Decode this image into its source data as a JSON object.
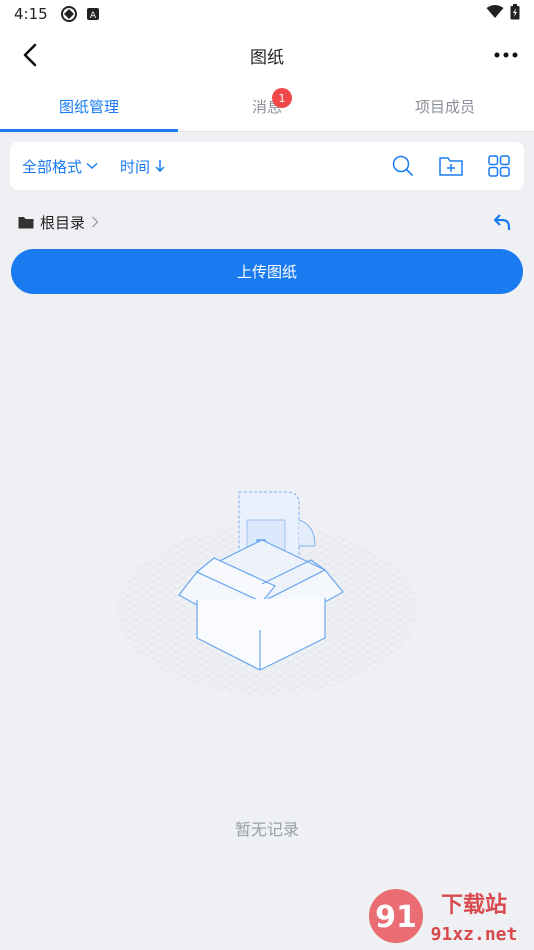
{
  "status_bar": {
    "time": "4:15",
    "icons": [
      "location-icon",
      "a-badge-icon",
      "wifi-icon",
      "battery-icon"
    ]
  },
  "app_bar": {
    "title": "图纸",
    "back_icon": "back-arrow-icon",
    "more_icon": "more-dots-icon"
  },
  "tabs": [
    {
      "label": "图纸管理",
      "active": true
    },
    {
      "label": "消息",
      "active": false,
      "badge": "1"
    },
    {
      "label": "项目成员",
      "active": false
    }
  ],
  "filter_bar": {
    "format_label": "全部格式",
    "sort_label": "时间",
    "icons": [
      "search-icon",
      "new-folder-icon",
      "grid-view-icon"
    ]
  },
  "breadcrumb": {
    "root_label": "根目录"
  },
  "upload_button": {
    "label": "上传图纸"
  },
  "empty_state": {
    "text": "暂无记录"
  },
  "watermark": {
    "top_text": "下载站",
    "bottom_text": "91xz.net",
    "logo_text": "91"
  },
  "colors": {
    "accent": "#1a7bf0",
    "badge": "#f04848",
    "background": "#eef0f3"
  }
}
